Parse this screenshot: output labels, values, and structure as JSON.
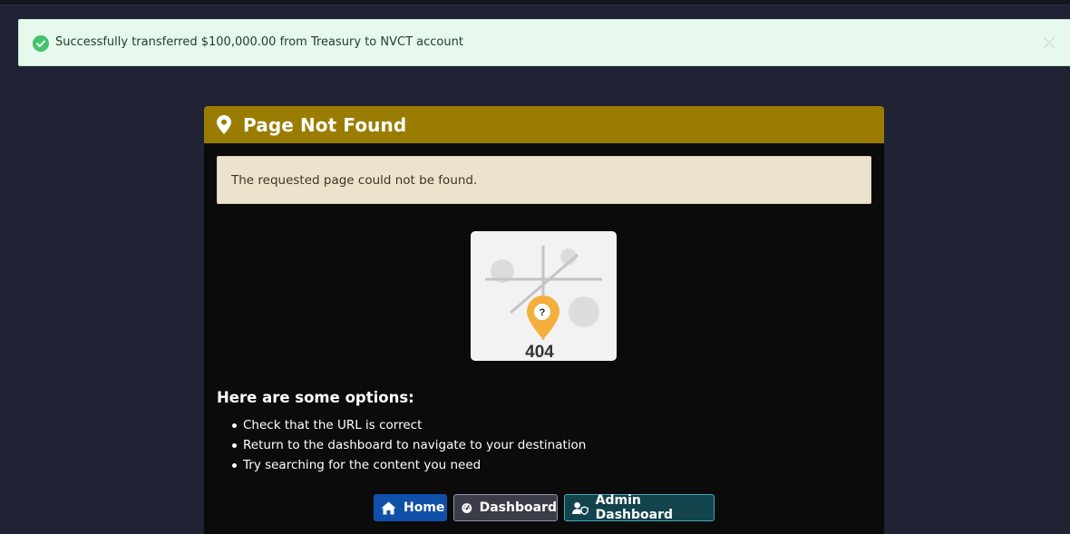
{
  "toast": {
    "icon": "check-circle-icon",
    "message": "Successfully transferred $100,000.00 from Treasury to NVCT account",
    "close_icon": "close-icon"
  },
  "card": {
    "icon": "map-pin-icon",
    "title": "Page Not Found",
    "alert_text": "The requested page could not be found.",
    "illustration": {
      "code": "404",
      "marker_label": "?"
    },
    "options_title": "Here are some options:",
    "options": [
      "Check that the URL is correct",
      "Return to the dashboard to navigate to your destination",
      "Try searching for the content you need"
    ],
    "buttons": {
      "home": "Home",
      "dashboard": "Dashboard",
      "admin_dashboard": "Admin Dashboard"
    }
  },
  "colors": {
    "page_bg": "#1f2333",
    "header_bg": "#9a7d00",
    "toast_bg": "#e6f9ec",
    "success_green": "#43c26b",
    "home_button": "#1150a8",
    "admin_button": "#13434c"
  }
}
